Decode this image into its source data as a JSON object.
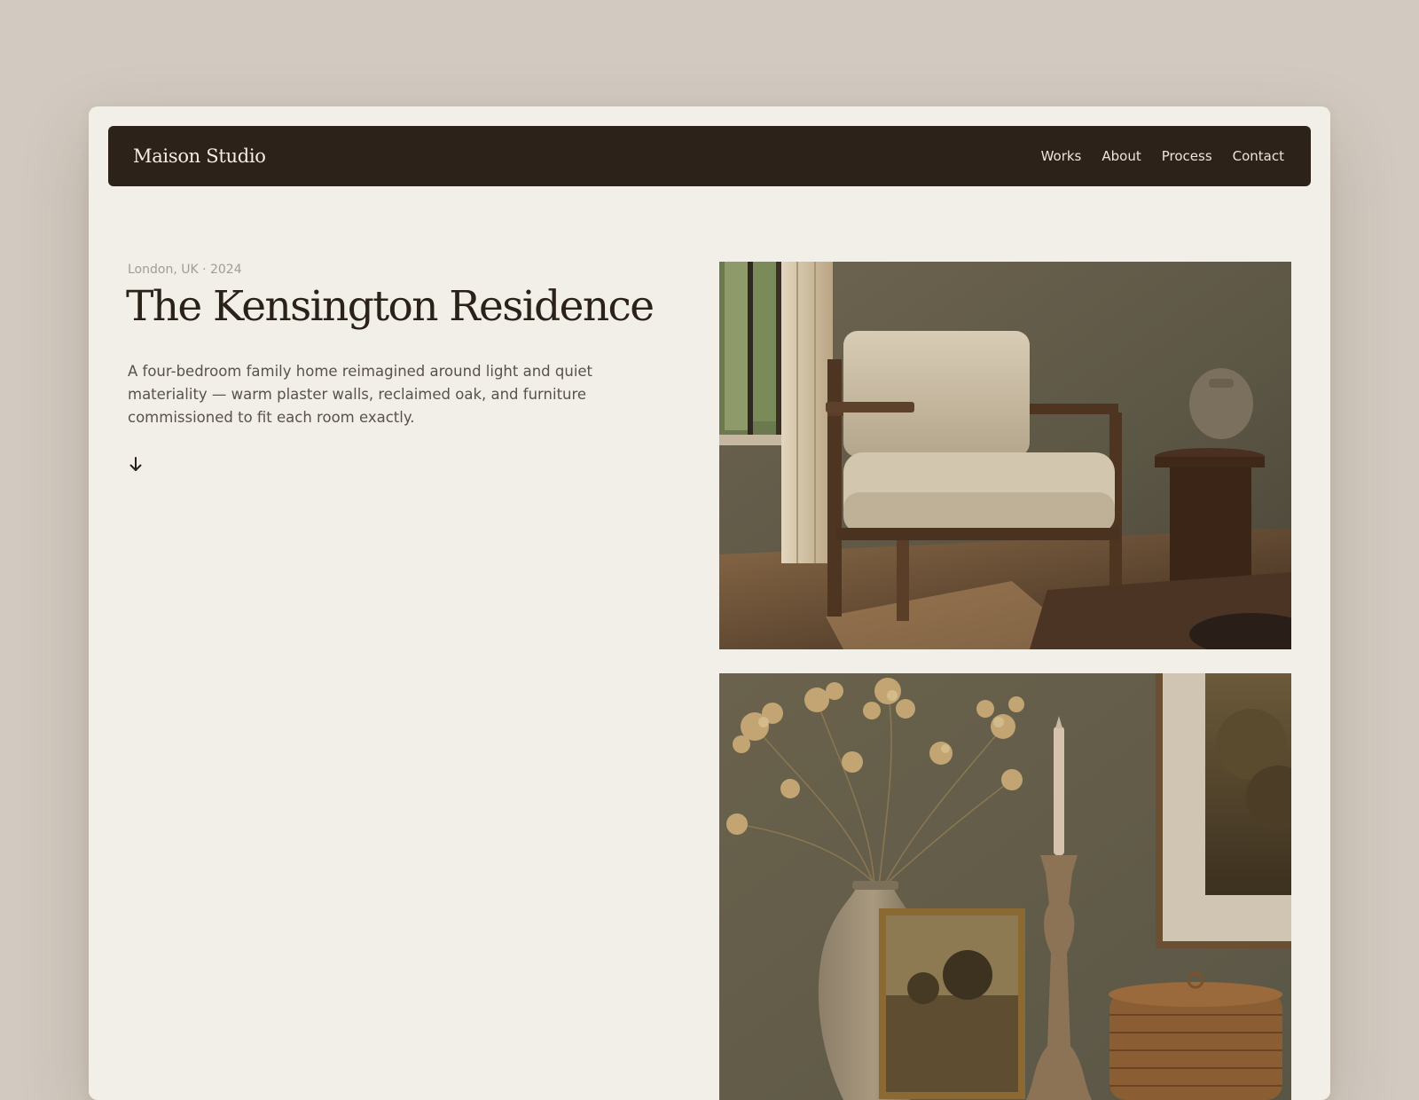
{
  "brand": "Maison Studio",
  "nav": [
    "Works",
    "About",
    "Process",
    "Contact"
  ],
  "project": {
    "meta": "London, UK · 2024",
    "title": "The Kensington Residence",
    "description": "A four-bedroom family home reimagined around light and quiet materiality — warm plaster walls, reclaimed oak, and furniture commissioned to fit each room exactly."
  },
  "icons": {
    "scroll": "arrow-down-icon"
  },
  "colors": {
    "page_bg": "#d2cac0",
    "card_bg": "#f2efe8",
    "navbar": "#2c221a",
    "title_text": "#2a2119",
    "body_text": "#5a524a",
    "meta_text": "#a49c92"
  }
}
